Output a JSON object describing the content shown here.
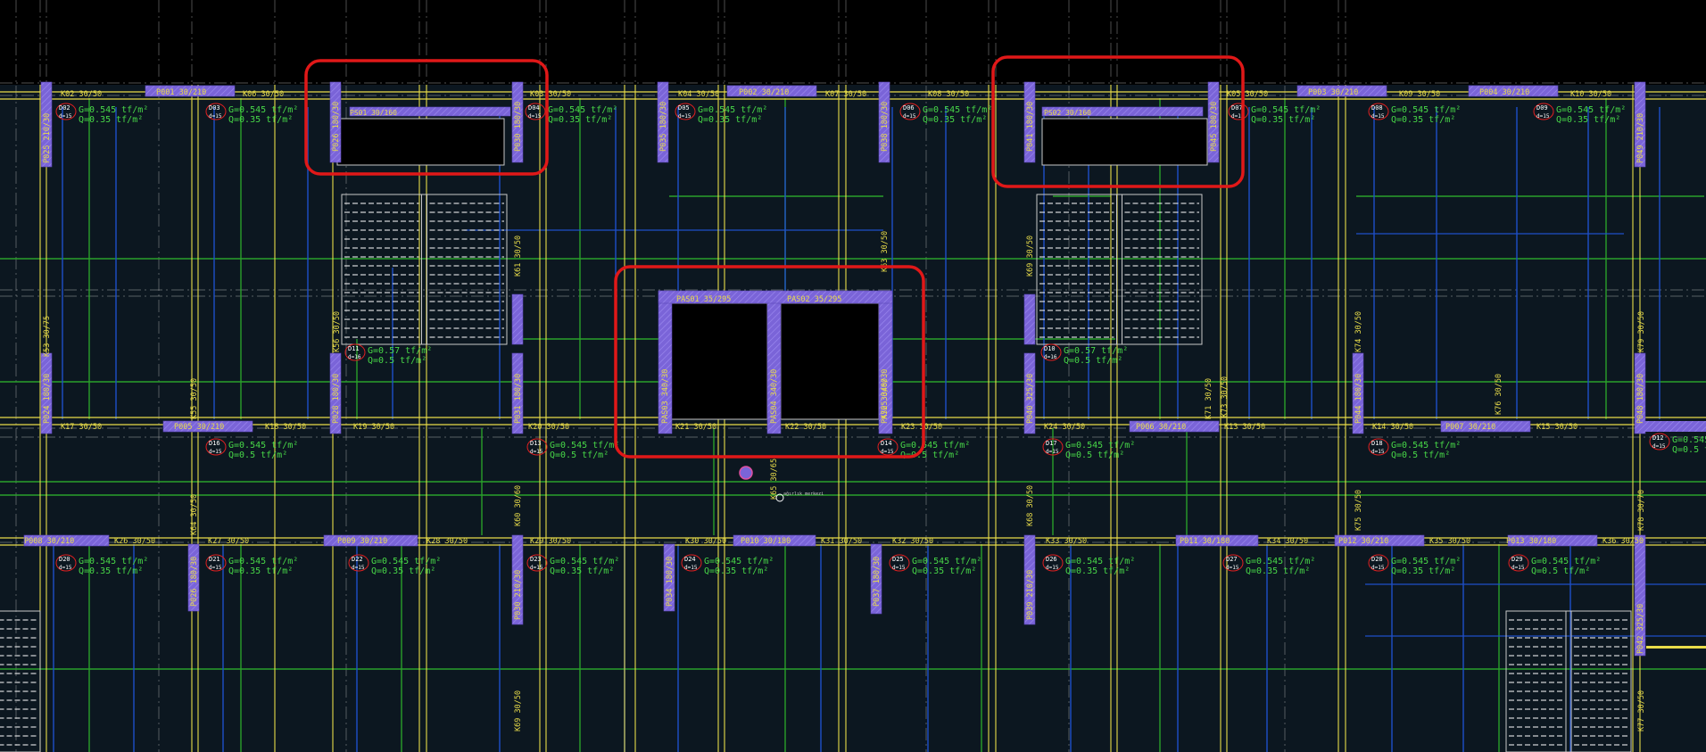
{
  "colors": {
    "background": "#000000",
    "slab": "#0c1720",
    "beam": "#e8dc4a",
    "column": "#7a64d8",
    "slab_arrow": "#1e4fc8",
    "load_text": "#48d848",
    "highlight": "#e01818",
    "axis": "#c8c8c8",
    "slab_badge": "#e02020"
  },
  "top_beams": {
    "k02": "K02 30/50",
    "p001": "P001 30/210",
    "k06": "K06 30/50",
    "k03": "K03 30/50",
    "k04": "K04 30/50",
    "p002": "P002 30/210",
    "k07": "K07 30/50",
    "k08": "K08 30/50",
    "k05": "K05 30/50",
    "p003": "P003 30/210",
    "k09": "K09 30/50",
    "p004": "P004 30/210",
    "k10": "K10 30/50"
  },
  "mid_beams": {
    "k17": "K17 30/50",
    "p005": "P005 30/210",
    "k18": "K18 30/50",
    "k19": "K19 30/50",
    "k20": "K20 30/50",
    "k21": "K21 30/50",
    "k22": "K22 30/50",
    "k23": "K23 30/50",
    "k24": "K24 30/50",
    "p006": "P006 30/210",
    "k13": "K13 30/50",
    "k14": "K14 30/50",
    "p007": "P007 30/210",
    "k15": "K15 30/50"
  },
  "low_beams": {
    "p008": "P008 30/210",
    "k26": "K26 30/50",
    "k27": "K27 30/50",
    "p009": "P009 30/210",
    "k28": "K28 30/50",
    "k29": "K29 30/50",
    "k30": "K30 30/50",
    "p010": "P010 30/180",
    "k31": "K31 30/50",
    "k32": "K32 30/50",
    "k33": "K33 30/50",
    "p011": "P011 30/180",
    "k34": "K34 30/50",
    "p012": "P012 30/210",
    "k35": "K35 30/50",
    "p013": "P013 30/180",
    "k36": "K36 30/50"
  },
  "stair_beams": {
    "ps01": "PS01 30/160",
    "ps02": "PS02 30/160"
  },
  "wall_openings": {
    "pas01": "PAS01 35/295",
    "pas02": "PAS02 35/295"
  },
  "upper_columns": {
    "p025": "P025 210/30",
    "p026": "P026 180/30",
    "p030": "P030 180/30",
    "p035": "P035 180/30",
    "p038": "P038 180/30",
    "p041": "P041 180/30",
    "p045": "P045 180/30",
    "p049": "P049 210/30"
  },
  "middle_columns": {
    "p024": "P024 180/30",
    "p028": "P028 180/30",
    "p031": "P031 180/30",
    "pas03": "PAS03 340/30",
    "pas04": "PAS04 340/30",
    "pas05": "PAS05 340/30",
    "p040": "P040 325/30",
    "p044": "P044 180/30",
    "p048": "P048 180/30"
  },
  "lower_columns": {
    "p026b": "P026 180/30",
    "p030b": "P030 210/30",
    "p034": "P034 180/30",
    "p037": "P037 180/30",
    "p039": "P039 210/30",
    "p042": "P042 325/30"
  },
  "vertical_beam_labels": {
    "k53": "K53 30/75",
    "k56": "K56 30/50",
    "k61": "K61 30/50",
    "k55": "K55 30/50",
    "k60": "K60 30/60",
    "k63": "K63 30/50",
    "k64": "K64 30/50",
    "k69": "K69 30/50",
    "k71": "K71 30/50",
    "k74": "K74 30/50",
    "k76": "K76 30/50",
    "k79": "K79 30/50",
    "k72": "K72 30/60",
    "k73": "K73 30/50",
    "k78": "K78 30/70",
    "k77": "K77 30/50",
    "k68": "K68 30/50",
    "k75": "K75 30/50",
    "k65": "K65 30/65"
  },
  "slabs": {
    "d02": {
      "id": "D02",
      "t": "d=15",
      "g": "G=0.545 tf/m²",
      "q": "Q=0.35 tf/m²"
    },
    "d03": {
      "id": "D03",
      "t": "d=15",
      "g": "G=0.545 tf/m²",
      "q": "Q=0.35 tf/m²"
    },
    "d04": {
      "id": "D04",
      "t": "d=15",
      "g": "G=0.545 tf/m²",
      "q": "Q=0.35 tf/m²"
    },
    "d05": {
      "id": "D05",
      "t": "d=15",
      "g": "G=0.545 tf/m²",
      "q": "Q=0.35 tf/m²"
    },
    "d06": {
      "id": "D06",
      "t": "d=15",
      "g": "G=0.545 tf/m²",
      "q": "Q=0.35 tf/m²"
    },
    "d07": {
      "id": "D07",
      "t": "d=15",
      "g": "G=0.545 tf/m²",
      "q": "Q=0.35 tf/m²"
    },
    "d08": {
      "id": "D08",
      "t": "d=15",
      "g": "G=0.545 tf/m²",
      "q": "Q=0.35 tf/m²"
    },
    "d09": {
      "id": "D09",
      "t": "d=15",
      "g": "G=0.545 tf/m²",
      "q": "Q=0.35 tf/m²"
    },
    "d11": {
      "id": "D11",
      "t": "d=16",
      "g": "G=0.57 tf/m²",
      "q": "Q=0.5 tf/m²"
    },
    "d10": {
      "id": "D10",
      "t": "d=16",
      "g": "G=0.57 tf/m²",
      "q": "Q=0.5 tf/m²"
    },
    "d16": {
      "id": "D16",
      "t": "d=15",
      "g": "G=0.545 tf/m²",
      "q": "Q=0.5 tf/m²"
    },
    "d13": {
      "id": "D13",
      "t": "d=15",
      "g": "G=0.545 tf/m²",
      "q": "Q=0.5 tf/m²"
    },
    "d14": {
      "id": "D14",
      "t": "d=15",
      "g": "G=0.545 tf/m²",
      "q": "Q=0.5 tf/m²"
    },
    "d17": {
      "id": "D17",
      "t": "d=15",
      "g": "G=0.545 tf/m²",
      "q": "Q=0.5 tf/m²"
    },
    "d18": {
      "id": "D18",
      "t": "d=15",
      "g": "G=0.545 tf/m²",
      "q": "Q=0.5 tf/m²"
    },
    "d12": {
      "id": "D12",
      "t": "d=15",
      "g": "G=0.545 tf/m²",
      "q": "Q=0.5 tf/m²"
    },
    "d20": {
      "id": "D20",
      "t": "d=15",
      "g": "G=0.545 tf/m²",
      "q": "Q=0.35 tf/m²"
    },
    "d21": {
      "id": "D21",
      "t": "d=15",
      "g": "G=0.545 tf/m²",
      "q": "Q=0.35 tf/m²"
    },
    "d22": {
      "id": "D22",
      "t": "d=15",
      "g": "G=0.545 tf/m²",
      "q": "Q=0.35 tf/m²"
    },
    "d23": {
      "id": "D23",
      "t": "d=15",
      "g": "G=0.545 tf/m²",
      "q": "Q=0.35 tf/m²"
    },
    "d24": {
      "id": "D24",
      "t": "d=15",
      "g": "G=0.545 tf/m²",
      "q": "Q=0.35 tf/m²"
    },
    "d25": {
      "id": "D25",
      "t": "d=15",
      "g": "G=0.545 tf/m²",
      "q": "Q=0.35 tf/m²"
    },
    "d26": {
      "id": "D26",
      "t": "d=15",
      "g": "G=0.545 tf/m²",
      "q": "Q=0.35 tf/m²"
    },
    "d27": {
      "id": "D27",
      "t": "d=15",
      "g": "G=0.545 tf/m²",
      "q": "Q=0.35 tf/m²"
    },
    "d28": {
      "id": "D28",
      "t": "d=15",
      "g": "G=0.545 tf/m²",
      "q": "Q=0.35 tf/m²"
    },
    "d29": {
      "id": "D29",
      "t": "d=15",
      "g": "G=0.545 tf/m²",
      "q": "Q=0.5 tf/m²"
    }
  },
  "misc": {
    "marker_text": "ağırlık merkezi"
  }
}
